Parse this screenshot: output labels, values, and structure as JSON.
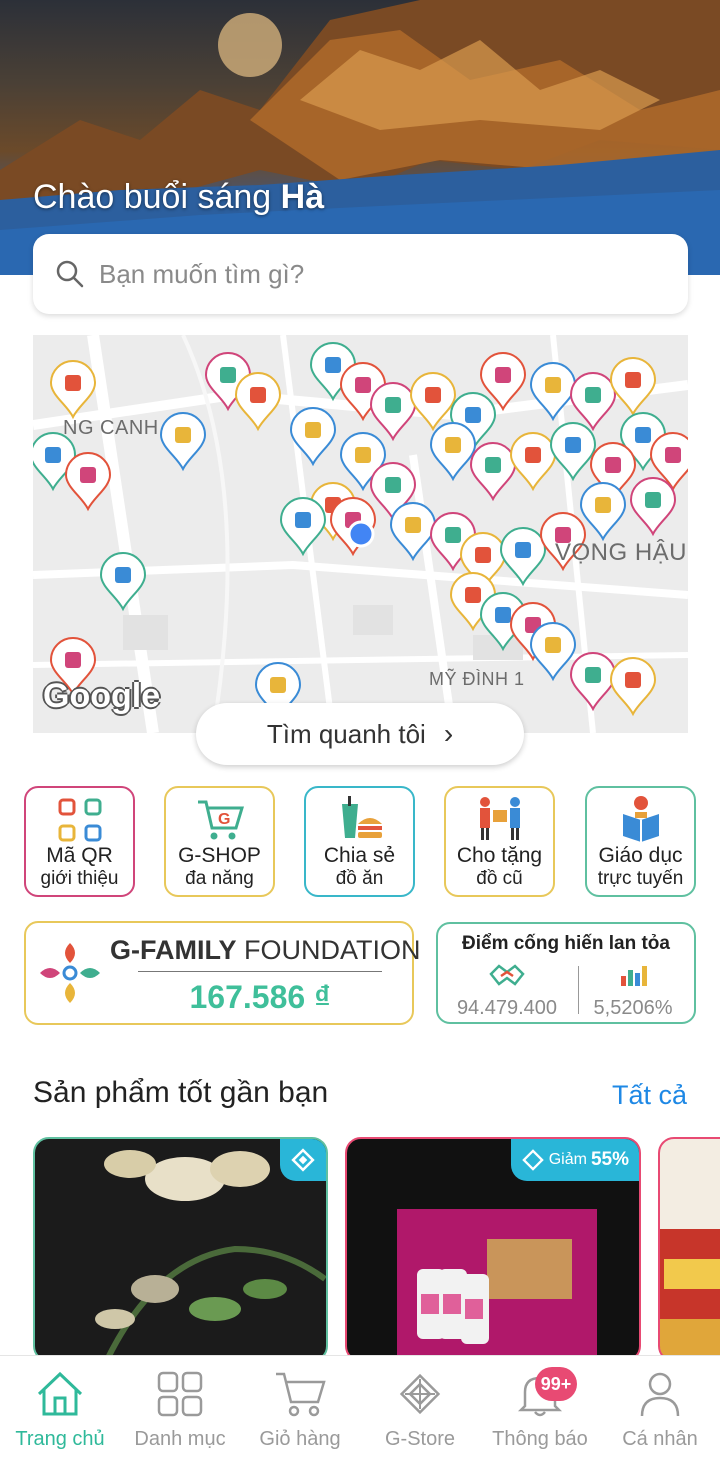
{
  "header": {
    "greeting_prefix": "Chào buổi sáng",
    "user_name": "Hà"
  },
  "search": {
    "placeholder": "Bạn muốn tìm gì?"
  },
  "map": {
    "labels": [
      "NG CANH",
      "VỌNG HẬU",
      "MỸ ĐÌNH 1"
    ],
    "provider_text": "Google",
    "find_near_button": "Tìm quanh tôi"
  },
  "quick_actions": [
    {
      "line1": "Mã QR",
      "line2": "giới thiệu",
      "icon": "qr-icon",
      "border_color": "#d0457a"
    },
    {
      "line1": "G-SHOP",
      "line2": "đa năng",
      "icon": "shop-cart-icon",
      "border_color": "#e8c85a"
    },
    {
      "line1": "Chia sẻ",
      "line2": "đồ ăn",
      "icon": "food-icon",
      "border_color": "#39b7c9"
    },
    {
      "line1": "Cho tặng",
      "line2": "đồ cũ",
      "icon": "give-icon",
      "border_color": "#e8c85a"
    },
    {
      "line1": "Giáo dục",
      "line2": "trực tuyến",
      "icon": "education-icon",
      "border_color": "#5fc0a0"
    }
  ],
  "foundation": {
    "brand": "G-FAMILY",
    "suffix": "FOUNDATION",
    "amount": "167.586 ₫"
  },
  "points": {
    "title": "Điểm cống hiến lan tỏa",
    "value_left": "94.479.400",
    "value_right": "5,5206%"
  },
  "products": {
    "section_title": "Sản phẩm tốt gần bạn",
    "see_all": "Tất cả",
    "discount_label": "Giảm",
    "discount_value": "55%"
  },
  "nav": [
    {
      "label": "Trang chủ",
      "icon": "home-icon",
      "active": true
    },
    {
      "label": "Danh mục",
      "icon": "grid-icon"
    },
    {
      "label": "Giỏ hàng",
      "icon": "cart-icon"
    },
    {
      "label": "G-Store",
      "icon": "store-icon"
    },
    {
      "label": "Thông báo",
      "icon": "bell-icon",
      "badge": "99+"
    },
    {
      "label": "Cá nhân",
      "icon": "user-icon"
    }
  ],
  "colors": {
    "accent": "#2fb99a",
    "link": "#1e88e5",
    "badge": "#e84a73"
  }
}
